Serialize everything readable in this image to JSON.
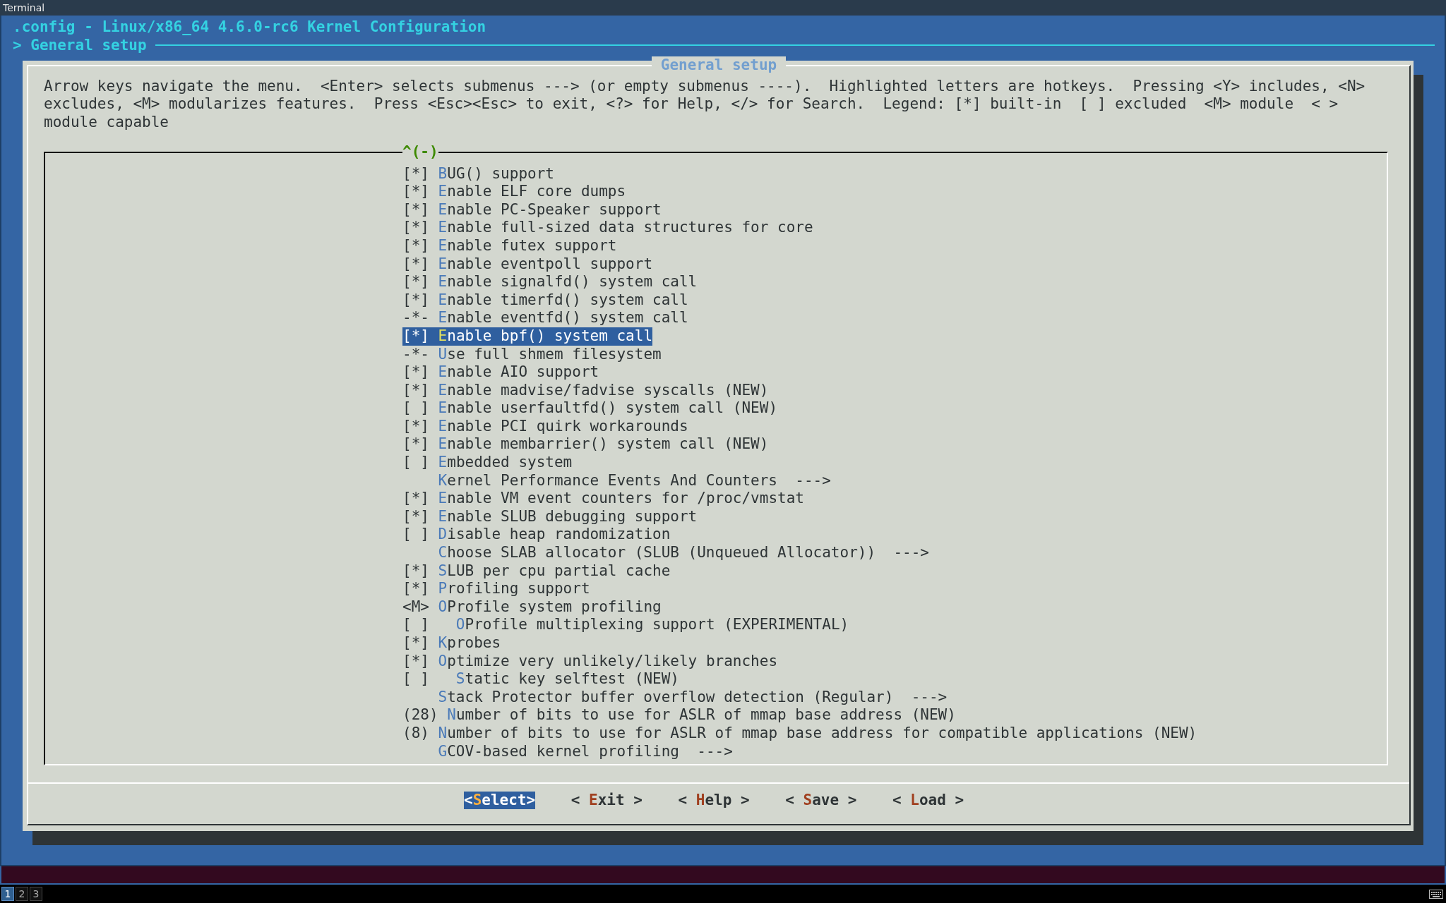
{
  "window": {
    "title": "Terminal"
  },
  "header": {
    "title": ".config - Linux/x86_64 4.6.0-rc6 Kernel Configuration",
    "breadcrumb": "> General setup"
  },
  "dialog": {
    "title": "General setup",
    "help": "Arrow keys navigate the menu.  <Enter> selects submenus ---> (or empty submenus ----).  Highlighted letters are hotkeys.  Pressing <Y> includes, <N> excludes, <M> modularizes features.  Press <Esc><Esc> to exit, <?> for Help, </> for Search.  Legend: [*] built-in  [ ] excluded  <M> module  < > module capable",
    "scroll_indicator": "^(-)",
    "items": [
      {
        "prefix": "[*]",
        "hotkey": "B",
        "label": "UG() support",
        "selected": false
      },
      {
        "prefix": "[*]",
        "hotkey": "E",
        "label": "nable ELF core dumps",
        "selected": false
      },
      {
        "prefix": "[*]",
        "hotkey": "E",
        "label": "nable PC-Speaker support",
        "selected": false
      },
      {
        "prefix": "[*]",
        "hotkey": "E",
        "label": "nable full-sized data structures for core",
        "selected": false
      },
      {
        "prefix": "[*]",
        "hotkey": "E",
        "label": "nable futex support",
        "selected": false
      },
      {
        "prefix": "[*]",
        "hotkey": "E",
        "label": "nable eventpoll support",
        "selected": false
      },
      {
        "prefix": "[*]",
        "hotkey": "E",
        "label": "nable signalfd() system call",
        "selected": false
      },
      {
        "prefix": "[*]",
        "hotkey": "E",
        "label": "nable timerfd() system call",
        "selected": false
      },
      {
        "prefix": "-*-",
        "hotkey": "E",
        "label": "nable eventfd() system call",
        "selected": false
      },
      {
        "prefix": "[*]",
        "hotkey": "E",
        "label": "nable bpf() system call",
        "selected": true
      },
      {
        "prefix": "-*-",
        "hotkey": "U",
        "label": "se full shmem filesystem",
        "selected": false
      },
      {
        "prefix": "[*]",
        "hotkey": "E",
        "label": "nable AIO support",
        "selected": false
      },
      {
        "prefix": "[*]",
        "hotkey": "E",
        "label": "nable madvise/fadvise syscalls (NEW)",
        "selected": false
      },
      {
        "prefix": "[ ]",
        "hotkey": "E",
        "label": "nable userfaultfd() system call (NEW)",
        "selected": false
      },
      {
        "prefix": "[*]",
        "hotkey": "E",
        "label": "nable PCI quirk workarounds",
        "selected": false
      },
      {
        "prefix": "[*]",
        "hotkey": "E",
        "label": "nable membarrier() system call (NEW)",
        "selected": false
      },
      {
        "prefix": "[ ]",
        "hotkey": "E",
        "label": "mbedded system",
        "selected": false
      },
      {
        "hotkey": "K",
        "label": "ernel Performance Events And Counters",
        "arrow": "--->",
        "selected": false
      },
      {
        "prefix": "[*]",
        "hotkey": "E",
        "label": "nable VM event counters for /proc/vmstat",
        "selected": false
      },
      {
        "prefix": "[*]",
        "hotkey": "E",
        "label": "nable SLUB debugging support",
        "selected": false
      },
      {
        "prefix": "[ ]",
        "hotkey": "D",
        "label": "isable heap randomization",
        "selected": false
      },
      {
        "hotkey": "C",
        "label": "hoose SLAB allocator (SLUB (Unqueued Allocator))",
        "arrow": "--->",
        "selected": false
      },
      {
        "prefix": "[*]",
        "hotkey": "S",
        "label": "LUB per cpu partial cache",
        "selected": false
      },
      {
        "prefix": "[*]",
        "hotkey": "P",
        "label": "rofiling support",
        "selected": false
      },
      {
        "prefix": "<M>",
        "hotkey": "O",
        "label": "Profile system profiling",
        "selected": false,
        "children": [
          {
            "prefix": "[ ]",
            "hotkey": "O",
            "label": "Profile multiplexing support (EXPERIMENTAL)",
            "selected": false
          }
        ]
      },
      {
        "prefix": "[*]",
        "hotkey": "K",
        "label": "probes",
        "selected": false
      },
      {
        "prefix": "[*]",
        "hotkey": "O",
        "label": "ptimize very unlikely/likely branches",
        "selected": false,
        "children": [
          {
            "prefix": "[ ]",
            "hotkey": "S",
            "label": "tatic key selftest (NEW)",
            "selected": false
          }
        ]
      },
      {
        "hotkey": "S",
        "label": "tack Protector buffer overflow detection (Regular)",
        "arrow": "--->",
        "selected": false
      },
      {
        "prefix": "(28)",
        "hotkey": "N",
        "label": "umber of bits to use for ASLR of mmap base address (NEW)",
        "selected": false
      },
      {
        "prefix": "(8)",
        "hotkey": "N",
        "label": "umber of bits to use for ASLR of mmap base address for compatible applications (NEW)",
        "selected": false
      },
      {
        "hotkey": "G",
        "label": "COV-based kernel profiling",
        "arrow": "--->",
        "selected": false
      }
    ],
    "buttons": [
      {
        "before": "<",
        "hotkey": "S",
        "rest": "elect>",
        "selected": true
      },
      {
        "before": "< ",
        "hotkey": "E",
        "rest": "xit >",
        "selected": false
      },
      {
        "before": "< ",
        "hotkey": "H",
        "rest": "elp >",
        "selected": false
      },
      {
        "before": "< ",
        "hotkey": "S",
        "rest": "ave >",
        "selected": false
      },
      {
        "before": "< ",
        "hotkey": "L",
        "rest": "oad >",
        "selected": false
      }
    ]
  },
  "taskbar": {
    "workspaces": [
      {
        "label": "1",
        "selected": true
      },
      {
        "label": "2",
        "selected": false
      },
      {
        "label": "3",
        "selected": false
      }
    ]
  }
}
